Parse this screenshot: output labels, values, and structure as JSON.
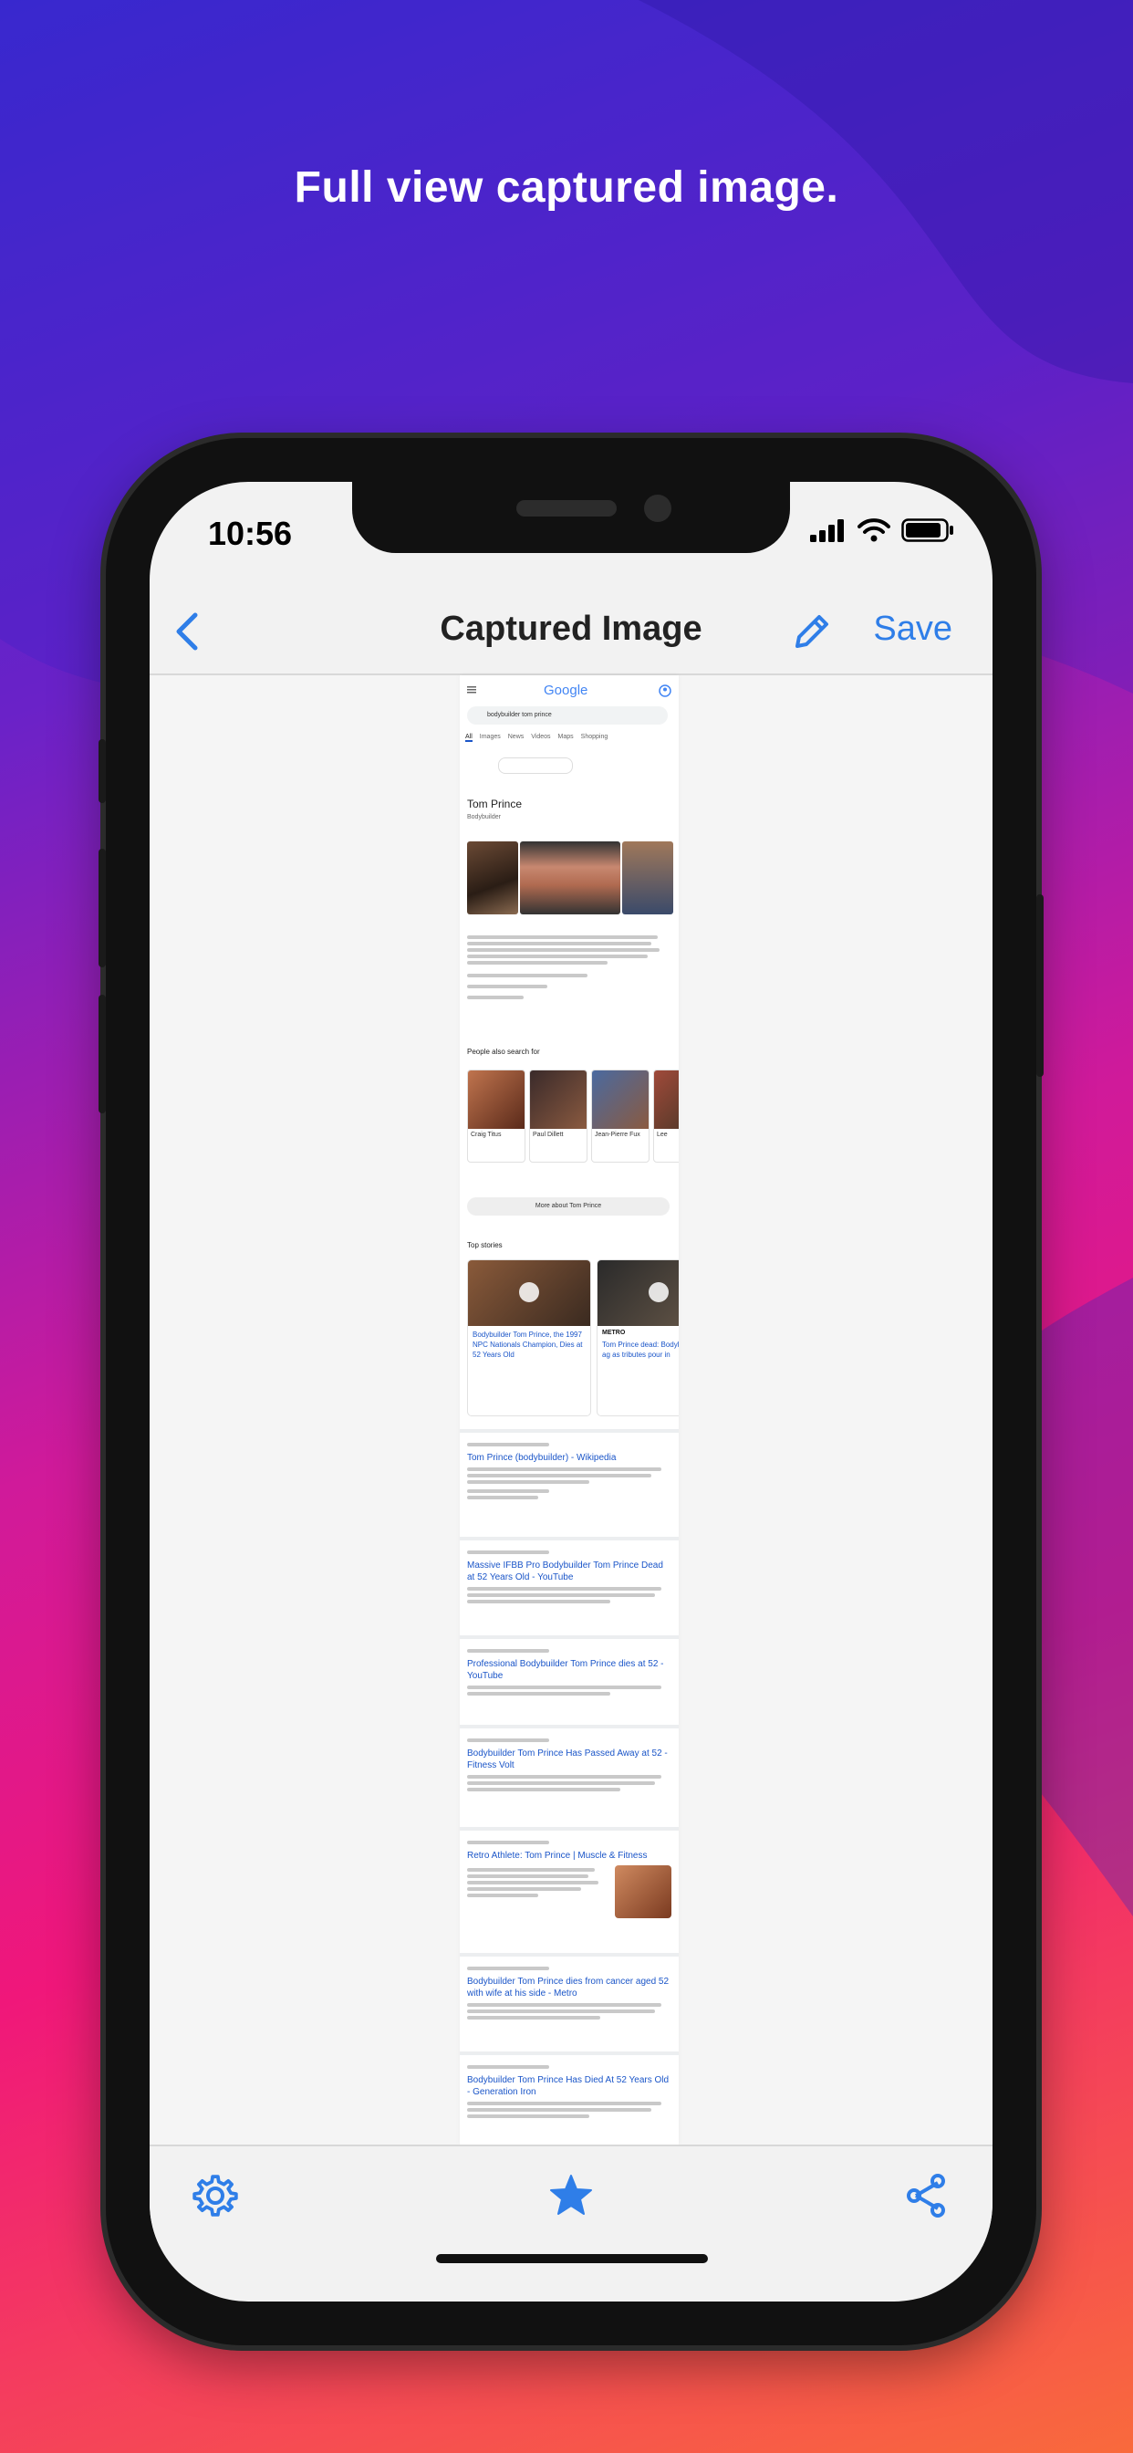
{
  "headline": "Full view captured image.",
  "status": {
    "time": "10:56"
  },
  "navbar": {
    "title": "Captured Image",
    "save_label": "Save"
  },
  "captured_page": {
    "logo": "Google",
    "query": "bodybuilder tom prince",
    "tabs": [
      "All",
      "Images",
      "News",
      "Videos",
      "Maps",
      "Shopping"
    ],
    "entity_title": "Tom Prince",
    "entity_subtitle": "Bodybuilder",
    "people_header": "People also search for",
    "people": [
      "Craig Titus",
      "Paul Dillett",
      "Jean-Pierre Fux",
      "Lee"
    ],
    "more_about": "More about Tom Prince",
    "top_stories_header": "Top stories",
    "stories": [
      {
        "source": "",
        "title": "Bodybuilder Tom Prince, the 1997 NPC Nationals Champion, Dies at 52 Years Old"
      },
      {
        "source": "METRO",
        "title": "Tom Prince dead: Bodybuilder dies ag as tributes pour in"
      }
    ],
    "results": [
      {
        "title": "Tom Prince (bodybuilder) - Wikipedia"
      },
      {
        "title": "Massive IFBB Pro Bodybuilder Tom Prince Dead at 52 Years Old - YouTube"
      },
      {
        "title": "Professional Bodybuilder Tom Prince dies at 52 - YouTube"
      },
      {
        "title": "Bodybuilder Tom Prince Has Passed Away at 52 - Fitness Volt"
      },
      {
        "title": "Retro Athlete: Tom Prince | Muscle & Fitness"
      },
      {
        "title": "Bodybuilder Tom Prince dies from cancer aged 52 with wife at his side - Metro"
      },
      {
        "title": "Bodybuilder Tom Prince Has Died At 52 Years Old - Generation Iron"
      }
    ]
  },
  "colors": {
    "accent": "#2f7ee8"
  },
  "icons": {
    "back": "chevron-left-icon",
    "edit": "pencil-icon",
    "settings": "gear-icon",
    "favorite": "star-icon",
    "share": "share-icon"
  }
}
